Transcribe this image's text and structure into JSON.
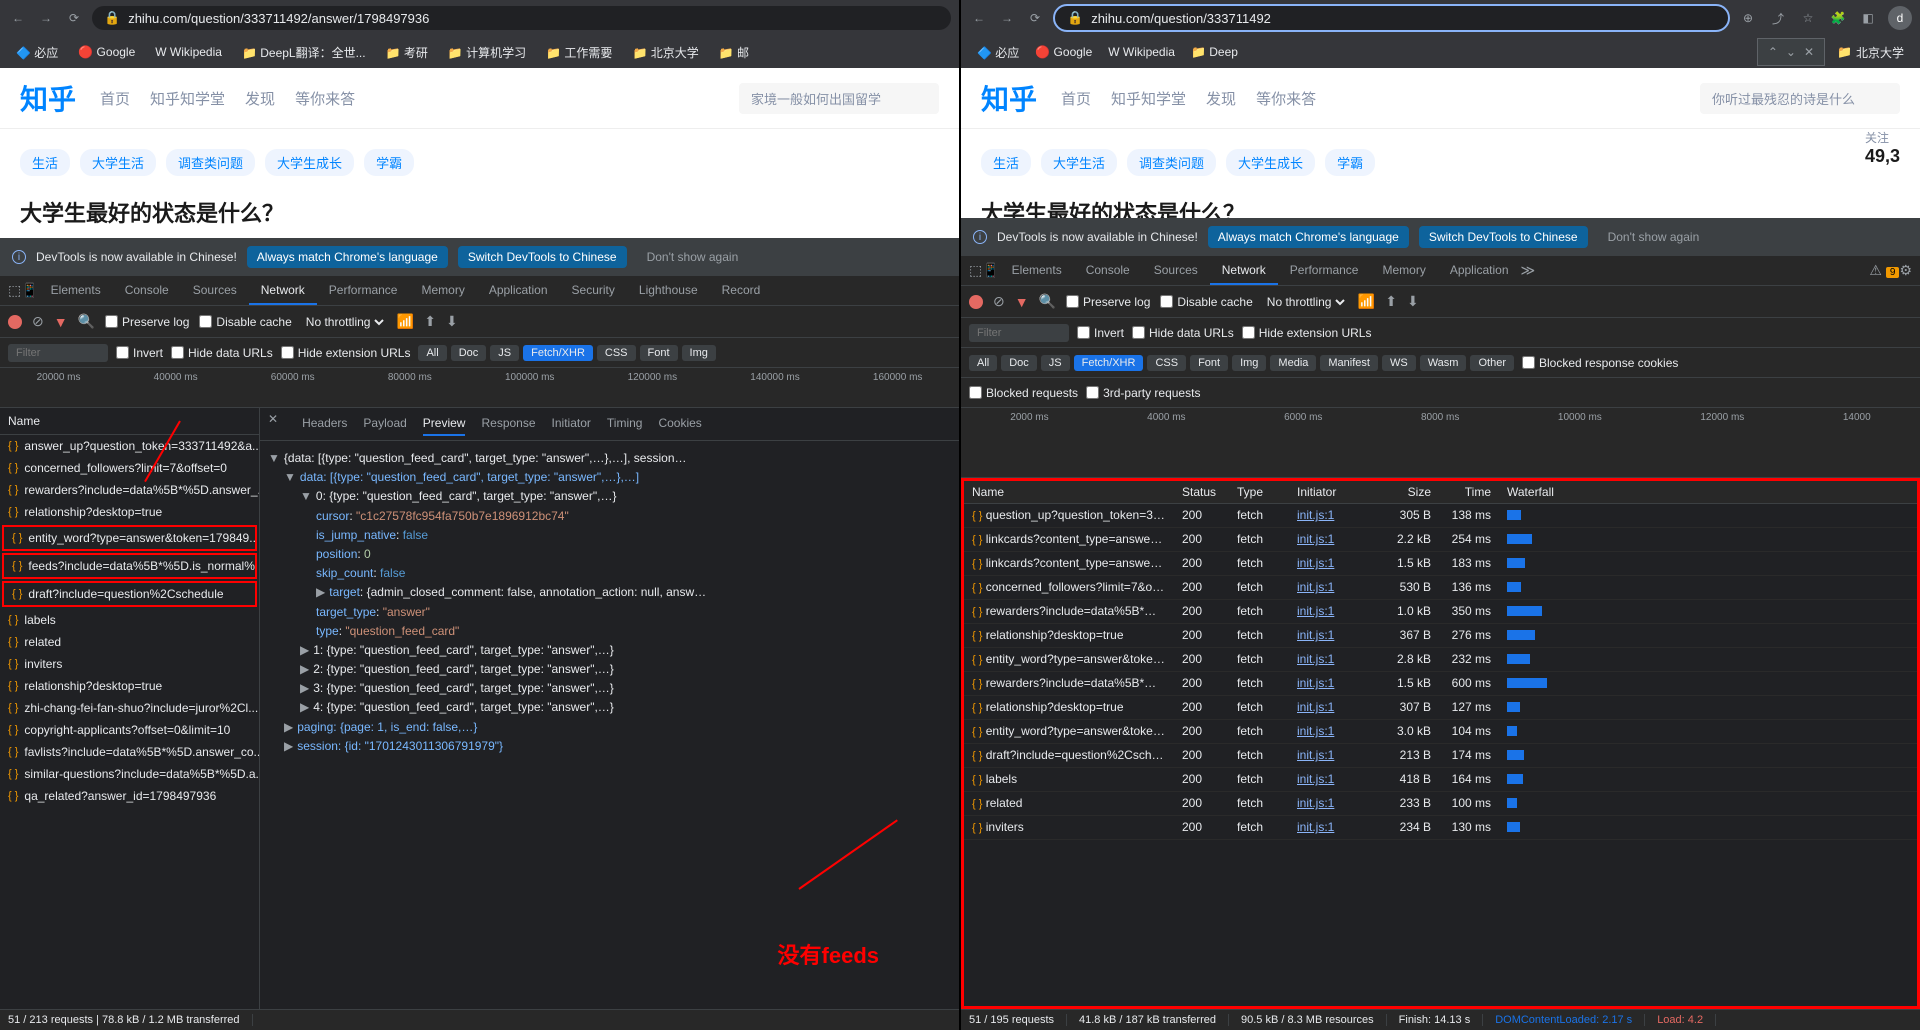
{
  "left": {
    "url": "zhihu.com/question/333711492/answer/1798497936",
    "bookmarks": [
      "必应",
      "Google",
      "Wikipedia",
      "DeepL翻译：全世...",
      "考研",
      "计算机学习",
      "工作需要",
      "北京大学",
      "邮"
    ],
    "zhihu": {
      "logo": "知乎",
      "nav": [
        "首页",
        "知乎知学堂",
        "发现",
        "等你来答"
      ],
      "search_placeholder": "家境一般如何出国留学",
      "tags": [
        "生活",
        "大学生活",
        "调查类问题",
        "大学生成长",
        "学霸"
      ],
      "question": "大学生最好的状态是什么？"
    },
    "banner": {
      "text": "DevTools is now available in Chinese!",
      "btn1": "Always match Chrome's language",
      "btn2": "Switch DevTools to Chinese",
      "btn3": "Don't show again"
    },
    "devtools_tabs": [
      "Elements",
      "Console",
      "Sources",
      "Network",
      "Performance",
      "Memory",
      "Application",
      "Security",
      "Lighthouse",
      "Record"
    ],
    "toolbar": {
      "preserve": "Preserve log",
      "disable": "Disable cache",
      "throttle": "No throttling"
    },
    "filter": {
      "placeholder": "Filter",
      "invert": "Invert",
      "hide_urls": "Hide data URLs",
      "hide_ext": "Hide extension URLs"
    },
    "chips": [
      "All",
      "Doc",
      "JS",
      "Fetch/XHR",
      "CSS",
      "Font",
      "Img"
    ],
    "timeline_labels": [
      "20000 ms",
      "40000 ms",
      "60000 ms",
      "80000 ms",
      "100000 ms",
      "120000 ms",
      "140000 ms",
      "160000 ms"
    ],
    "list_header": "Name",
    "requests": [
      "answer_up?question_token=333711492&a...",
      "concerned_followers?limit=7&offset=0",
      "rewarders?include=data%5B*%5D.answer_...",
      "relationship?desktop=true",
      "entity_word?type=answer&token=179849...",
      "feeds?include=data%5B*%5D.is_normal%2...",
      "draft?include=question%2Cschedule",
      "labels",
      "related",
      "inviters",
      "relationship?desktop=true",
      "zhi-chang-fei-fan-shuo?include=juror%2Cl...",
      "copyright-applicants?offset=0&limit=10",
      "favlists?include=data%5B*%5D.answer_co...",
      "similar-questions?include=data%5B*%5D.a...",
      "qa_related?answer_id=1798497936"
    ],
    "detail_tabs": [
      "Headers",
      "Payload",
      "Preview",
      "Response",
      "Initiator",
      "Timing",
      "Cookies"
    ],
    "json": {
      "root": "{data: [{type: \"question_feed_card\", target_type: \"answer\",…},…], session…",
      "data_line": "data: [{type: \"question_feed_card\", target_type: \"answer\",…},…]",
      "item0": "0: {type: \"question_feed_card\", target_type: \"answer\",…}",
      "cursor": "cursor: \"c1c27578fc954fa750b7e1896912bc74\"",
      "is_jump": "is_jump_native: false",
      "position": "position: 0",
      "skip": "skip_count: false",
      "target": "target: {admin_closed_comment: false, annotation_action: null, answ…",
      "target_type": "target_type: \"answer\"",
      "type": "type: \"question_feed_card\"",
      "item1": "1: {type: \"question_feed_card\", target_type: \"answer\",…}",
      "item2": "2: {type: \"question_feed_card\", target_type: \"answer\",…}",
      "item3": "3: {type: \"question_feed_card\", target_type: \"answer\",…}",
      "item4": "4: {type: \"question_feed_card\", target_type: \"answer\",…}",
      "paging": "paging: {page: 1, is_end: false,…}",
      "session": "session: {id: \"1701243011306791979\"}"
    },
    "status": "51 / 213 requests   |   78.8 kB / 1.2 MB transferred",
    "annotation": "没有feeds"
  },
  "right": {
    "url": "zhihu.com/question/333711492",
    "bookmarks": [
      "必应",
      "Google",
      "Wikipedia",
      "Deep"
    ],
    "bookmark_right": "北京大学",
    "zhihu": {
      "logo": "知乎",
      "nav": [
        "首页",
        "知乎知学堂",
        "发现",
        "等你来答"
      ],
      "search_placeholder": "你听过最残忍的诗是什么",
      "tags": [
        "生活",
        "大学生活",
        "调查类问题",
        "大学生成长",
        "学霸"
      ],
      "question": "大学生最好的状态是什么？",
      "follow_label": "关注",
      "follow_count": "49,3"
    },
    "banner": {
      "text": "DevTools is now available in Chinese!",
      "btn1": "Always match Chrome's language",
      "btn2": "Switch DevTools to Chinese",
      "btn3": "Don't show again"
    },
    "devtools_tabs": [
      "Elements",
      "Console",
      "Sources",
      "Network",
      "Performance",
      "Memory",
      "Application"
    ],
    "warn_count": "9",
    "toolbar": {
      "preserve": "Preserve log",
      "disable": "Disable cache",
      "throttle": "No throttling"
    },
    "filter": {
      "placeholder": "Filter",
      "invert": "Invert",
      "hide_urls": "Hide data URLs",
      "hide_ext": "Hide extension URLs"
    },
    "chips": [
      "All",
      "Doc",
      "JS",
      "Fetch/XHR",
      "CSS",
      "Font",
      "Img",
      "Media",
      "Manifest",
      "WS",
      "Wasm",
      "Other"
    ],
    "blocked_cookies": "Blocked response cookies",
    "blocked_req": "Blocked requests",
    "third_party": "3rd-party requests",
    "timeline_labels": [
      "2000 ms",
      "4000 ms",
      "6000 ms",
      "8000 ms",
      "10000 ms",
      "12000 ms",
      "14000"
    ],
    "table_headers": [
      "Name",
      "Status",
      "Type",
      "Initiator",
      "Size",
      "Time",
      "Waterfall"
    ],
    "rows": [
      {
        "name": "question_up?question_token=333...",
        "status": "200",
        "type": "fetch",
        "init": "init.js:1",
        "size": "305 B",
        "time": "138 ms"
      },
      {
        "name": "linkcards?content_type=answer&t...",
        "status": "200",
        "type": "fetch",
        "init": "init.js:1",
        "size": "2.2 kB",
        "time": "254 ms"
      },
      {
        "name": "linkcards?content_type=answer&t...",
        "status": "200",
        "type": "fetch",
        "init": "init.js:1",
        "size": "1.5 kB",
        "time": "183 ms"
      },
      {
        "name": "concerned_followers?limit=7&offs...",
        "status": "200",
        "type": "fetch",
        "init": "init.js:1",
        "size": "530 B",
        "time": "136 ms"
      },
      {
        "name": "rewarders?include=data%5B*%5D...",
        "status": "200",
        "type": "fetch",
        "init": "init.js:1",
        "size": "1.0 kB",
        "time": "350 ms"
      },
      {
        "name": "relationship?desktop=true",
        "status": "200",
        "type": "fetch",
        "init": "init.js:1",
        "size": "367 B",
        "time": "276 ms"
      },
      {
        "name": "entity_word?type=answer&token...",
        "status": "200",
        "type": "fetch",
        "init": "init.js:1",
        "size": "2.8 kB",
        "time": "232 ms"
      },
      {
        "name": "rewarders?include=data%5B*%5D...",
        "status": "200",
        "type": "fetch",
        "init": "init.js:1",
        "size": "1.5 kB",
        "time": "600 ms"
      },
      {
        "name": "relationship?desktop=true",
        "status": "200",
        "type": "fetch",
        "init": "init.js:1",
        "size": "307 B",
        "time": "127 ms"
      },
      {
        "name": "entity_word?type=answer&token...",
        "status": "200",
        "type": "fetch",
        "init": "init.js:1",
        "size": "3.0 kB",
        "time": "104 ms"
      },
      {
        "name": "draft?include=question%2Csched...",
        "status": "200",
        "type": "fetch",
        "init": "init.js:1",
        "size": "213 B",
        "time": "174 ms"
      },
      {
        "name": "labels",
        "status": "200",
        "type": "fetch",
        "init": "init.js:1",
        "size": "418 B",
        "time": "164 ms"
      },
      {
        "name": "related",
        "status": "200",
        "type": "fetch",
        "init": "init.js:1",
        "size": "233 B",
        "time": "100 ms"
      },
      {
        "name": "inviters",
        "status": "200",
        "type": "fetch",
        "init": "init.js:1",
        "size": "234 B",
        "time": "130 ms"
      }
    ],
    "status": {
      "req": "51 / 195 requests",
      "xfer": "41.8 kB / 187 kB transferred",
      "res": "90.5 kB / 8.3 MB resources",
      "finish": "Finish: 14.13 s",
      "dom": "DOMContentLoaded: 2.17 s",
      "load": "Load: 4.2"
    }
  }
}
